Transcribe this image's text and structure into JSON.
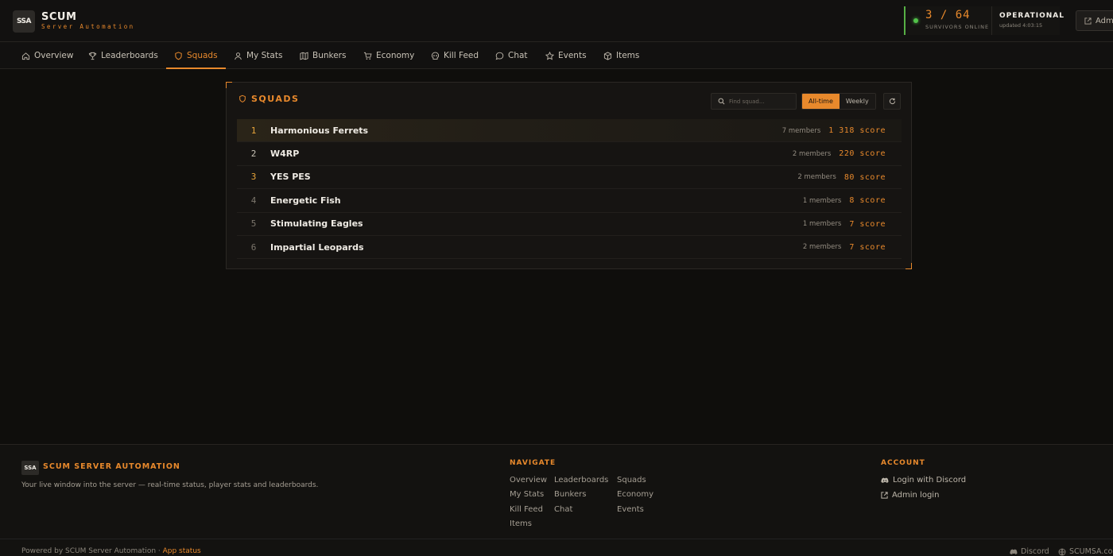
{
  "brand": {
    "logo_text": "SSA",
    "title": "SCUM",
    "subtitle": "Server Automation"
  },
  "status": {
    "online": "3 / 64",
    "online_label": "SURVIVORS ONLINE",
    "state": "OPERATIONAL",
    "updated": "updated 4:03:15"
  },
  "header": {
    "admin_label": "Admin"
  },
  "nav": {
    "items": [
      {
        "label": "Overview",
        "icon": "home-icon"
      },
      {
        "label": "Leaderboards",
        "icon": "trophy-icon"
      },
      {
        "label": "Squads",
        "icon": "shield-icon",
        "active": true
      },
      {
        "label": "My Stats",
        "icon": "user-icon"
      },
      {
        "label": "Bunkers",
        "icon": "map-icon"
      },
      {
        "label": "Economy",
        "icon": "cart-icon"
      },
      {
        "label": "Kill Feed",
        "icon": "skull-icon"
      },
      {
        "label": "Chat",
        "icon": "chat-icon"
      },
      {
        "label": "Events",
        "icon": "star-icon"
      },
      {
        "label": "Items",
        "icon": "box-icon"
      }
    ]
  },
  "squads": {
    "title": "SQUADS",
    "search_placeholder": "Find squad...",
    "filter_alltime": "All-time",
    "filter_weekly": "Weekly",
    "rows": [
      {
        "rank": "1",
        "name": "Harmonious Ferrets",
        "members": "7 members",
        "score": "1 318",
        "score_label": "score"
      },
      {
        "rank": "2",
        "name": "W4RP",
        "members": "2 members",
        "score": "220",
        "score_label": "score"
      },
      {
        "rank": "3",
        "name": "YES PES",
        "members": "2 members",
        "score": "80",
        "score_label": "score"
      },
      {
        "rank": "4",
        "name": "Energetic Fish",
        "members": "1 members",
        "score": "8",
        "score_label": "score"
      },
      {
        "rank": "5",
        "name": "Stimulating Eagles",
        "members": "1 members",
        "score": "7",
        "score_label": "score"
      },
      {
        "rank": "6",
        "name": "Impartial Leopards",
        "members": "2 members",
        "score": "7",
        "score_label": "score"
      }
    ]
  },
  "footer": {
    "brand": "SCUM SERVER AUTOMATION",
    "tagline": "Your live window into the server — real-time status, player stats and leaderboards.",
    "navigate_heading": "NAVIGATE",
    "navigate_links": [
      "Overview",
      "Leaderboards",
      "Squads",
      "My Stats",
      "Bunkers",
      "Economy",
      "Kill Feed",
      "Chat",
      "Events",
      "Items"
    ],
    "account_heading": "ACCOUNT",
    "login_discord": "Login with Discord",
    "admin_login": "Admin login",
    "powered_by": "Powered by SCUM Server Automation · ",
    "app_status": "App status",
    "discord": "Discord",
    "site": "SCUMSA.com"
  },
  "colors": {
    "accent": "#e8892c",
    "online": "#52c24a",
    "background": "#0f0e0c"
  }
}
